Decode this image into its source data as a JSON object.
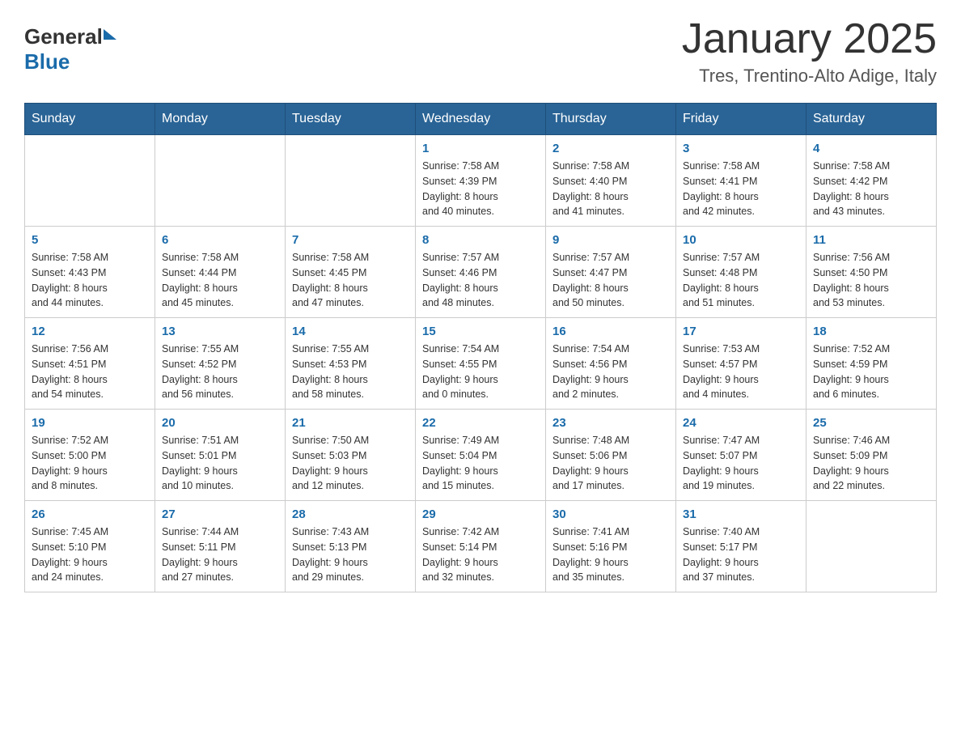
{
  "header": {
    "logo_general": "General",
    "logo_blue": "Blue",
    "month_title": "January 2025",
    "location": "Tres, Trentino-Alto Adige, Italy"
  },
  "days_of_week": [
    "Sunday",
    "Monday",
    "Tuesday",
    "Wednesday",
    "Thursday",
    "Friday",
    "Saturday"
  ],
  "weeks": [
    {
      "days": [
        {
          "number": "",
          "info": ""
        },
        {
          "number": "",
          "info": ""
        },
        {
          "number": "",
          "info": ""
        },
        {
          "number": "1",
          "info": "Sunrise: 7:58 AM\nSunset: 4:39 PM\nDaylight: 8 hours\nand 40 minutes."
        },
        {
          "number": "2",
          "info": "Sunrise: 7:58 AM\nSunset: 4:40 PM\nDaylight: 8 hours\nand 41 minutes."
        },
        {
          "number": "3",
          "info": "Sunrise: 7:58 AM\nSunset: 4:41 PM\nDaylight: 8 hours\nand 42 minutes."
        },
        {
          "number": "4",
          "info": "Sunrise: 7:58 AM\nSunset: 4:42 PM\nDaylight: 8 hours\nand 43 minutes."
        }
      ]
    },
    {
      "days": [
        {
          "number": "5",
          "info": "Sunrise: 7:58 AM\nSunset: 4:43 PM\nDaylight: 8 hours\nand 44 minutes."
        },
        {
          "number": "6",
          "info": "Sunrise: 7:58 AM\nSunset: 4:44 PM\nDaylight: 8 hours\nand 45 minutes."
        },
        {
          "number": "7",
          "info": "Sunrise: 7:58 AM\nSunset: 4:45 PM\nDaylight: 8 hours\nand 47 minutes."
        },
        {
          "number": "8",
          "info": "Sunrise: 7:57 AM\nSunset: 4:46 PM\nDaylight: 8 hours\nand 48 minutes."
        },
        {
          "number": "9",
          "info": "Sunrise: 7:57 AM\nSunset: 4:47 PM\nDaylight: 8 hours\nand 50 minutes."
        },
        {
          "number": "10",
          "info": "Sunrise: 7:57 AM\nSunset: 4:48 PM\nDaylight: 8 hours\nand 51 minutes."
        },
        {
          "number": "11",
          "info": "Sunrise: 7:56 AM\nSunset: 4:50 PM\nDaylight: 8 hours\nand 53 minutes."
        }
      ]
    },
    {
      "days": [
        {
          "number": "12",
          "info": "Sunrise: 7:56 AM\nSunset: 4:51 PM\nDaylight: 8 hours\nand 54 minutes."
        },
        {
          "number": "13",
          "info": "Sunrise: 7:55 AM\nSunset: 4:52 PM\nDaylight: 8 hours\nand 56 minutes."
        },
        {
          "number": "14",
          "info": "Sunrise: 7:55 AM\nSunset: 4:53 PM\nDaylight: 8 hours\nand 58 minutes."
        },
        {
          "number": "15",
          "info": "Sunrise: 7:54 AM\nSunset: 4:55 PM\nDaylight: 9 hours\nand 0 minutes."
        },
        {
          "number": "16",
          "info": "Sunrise: 7:54 AM\nSunset: 4:56 PM\nDaylight: 9 hours\nand 2 minutes."
        },
        {
          "number": "17",
          "info": "Sunrise: 7:53 AM\nSunset: 4:57 PM\nDaylight: 9 hours\nand 4 minutes."
        },
        {
          "number": "18",
          "info": "Sunrise: 7:52 AM\nSunset: 4:59 PM\nDaylight: 9 hours\nand 6 minutes."
        }
      ]
    },
    {
      "days": [
        {
          "number": "19",
          "info": "Sunrise: 7:52 AM\nSunset: 5:00 PM\nDaylight: 9 hours\nand 8 minutes."
        },
        {
          "number": "20",
          "info": "Sunrise: 7:51 AM\nSunset: 5:01 PM\nDaylight: 9 hours\nand 10 minutes."
        },
        {
          "number": "21",
          "info": "Sunrise: 7:50 AM\nSunset: 5:03 PM\nDaylight: 9 hours\nand 12 minutes."
        },
        {
          "number": "22",
          "info": "Sunrise: 7:49 AM\nSunset: 5:04 PM\nDaylight: 9 hours\nand 15 minutes."
        },
        {
          "number": "23",
          "info": "Sunrise: 7:48 AM\nSunset: 5:06 PM\nDaylight: 9 hours\nand 17 minutes."
        },
        {
          "number": "24",
          "info": "Sunrise: 7:47 AM\nSunset: 5:07 PM\nDaylight: 9 hours\nand 19 minutes."
        },
        {
          "number": "25",
          "info": "Sunrise: 7:46 AM\nSunset: 5:09 PM\nDaylight: 9 hours\nand 22 minutes."
        }
      ]
    },
    {
      "days": [
        {
          "number": "26",
          "info": "Sunrise: 7:45 AM\nSunset: 5:10 PM\nDaylight: 9 hours\nand 24 minutes."
        },
        {
          "number": "27",
          "info": "Sunrise: 7:44 AM\nSunset: 5:11 PM\nDaylight: 9 hours\nand 27 minutes."
        },
        {
          "number": "28",
          "info": "Sunrise: 7:43 AM\nSunset: 5:13 PM\nDaylight: 9 hours\nand 29 minutes."
        },
        {
          "number": "29",
          "info": "Sunrise: 7:42 AM\nSunset: 5:14 PM\nDaylight: 9 hours\nand 32 minutes."
        },
        {
          "number": "30",
          "info": "Sunrise: 7:41 AM\nSunset: 5:16 PM\nDaylight: 9 hours\nand 35 minutes."
        },
        {
          "number": "31",
          "info": "Sunrise: 7:40 AM\nSunset: 5:17 PM\nDaylight: 9 hours\nand 37 minutes."
        },
        {
          "number": "",
          "info": ""
        }
      ]
    }
  ]
}
